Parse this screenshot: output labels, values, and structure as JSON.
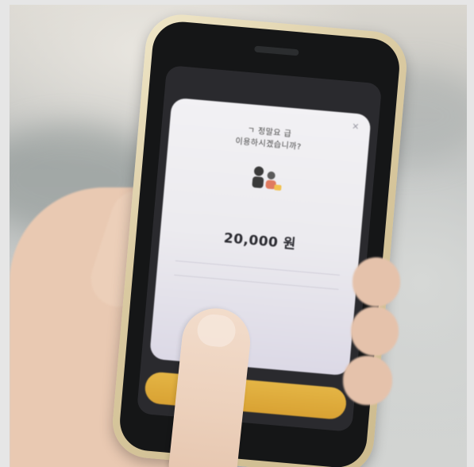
{
  "dialog": {
    "title_line1": "ㄱ 정말요 급",
    "title_line2": "이용하시겠습니까?",
    "description": "",
    "subtitle": "",
    "amount": "20,000 원",
    "cta_label": ""
  },
  "icons": {
    "close": "close-icon",
    "illustration": "people-illustration-icon"
  },
  "colors": {
    "cta": "#d9a233",
    "dialog_bg": "#efeef2",
    "phone_case": "#d9c9a0"
  }
}
